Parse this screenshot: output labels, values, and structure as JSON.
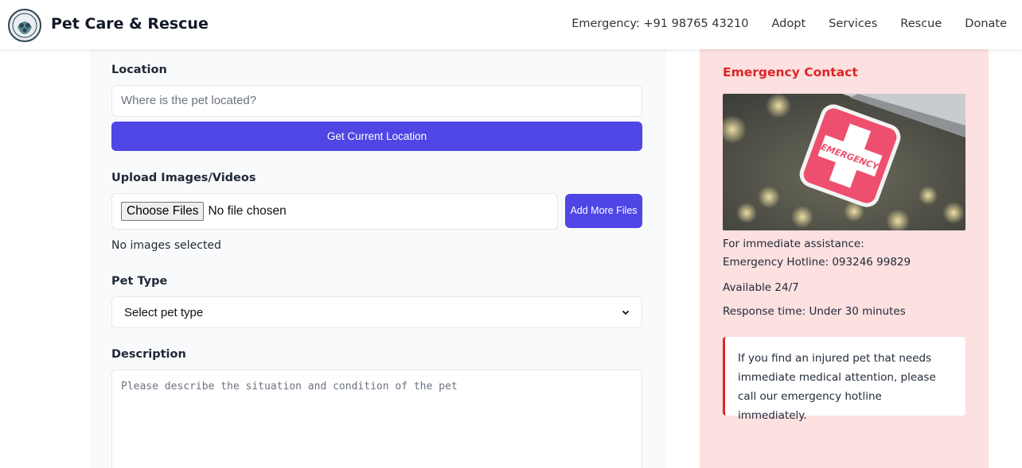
{
  "header": {
    "brand": "Pet Care & Rescue",
    "nav": {
      "emergency": "Emergency: +91 98765 43210",
      "adopt": "Adopt",
      "services": "Services",
      "rescue": "Rescue",
      "donate": "Donate"
    }
  },
  "form": {
    "location": {
      "label": "Location",
      "placeholder": "Where is the pet located?",
      "button": "Get Current Location"
    },
    "upload": {
      "label": "Upload Images/Videos",
      "choose_button": "Choose Files",
      "file_status": "No file chosen",
      "add_more_button": "Add More Files",
      "images_status": "No images selected"
    },
    "pet_type": {
      "label": "Pet Type",
      "selected": "Select pet type"
    },
    "description": {
      "label": "Description",
      "placeholder": "Please describe the situation and condition of the pet"
    }
  },
  "emergency_panel": {
    "title": "Emergency Contact",
    "sign_text": "EMERGENCY",
    "assist_line": "For immediate assistance:",
    "hotline_line": "Emergency Hotline: 093246 99829",
    "availability": "Available 24/7",
    "response_time": "Response time: Under 30 minutes",
    "notice": "If you find an injured pet that needs immediate medical attention, please call our emergency hotline immediately."
  },
  "colors": {
    "primary": "#4f46e5",
    "emergency_red": "#dc2626",
    "panel_pink": "#fde0e0",
    "sign_pink": "#ee4f6e"
  }
}
